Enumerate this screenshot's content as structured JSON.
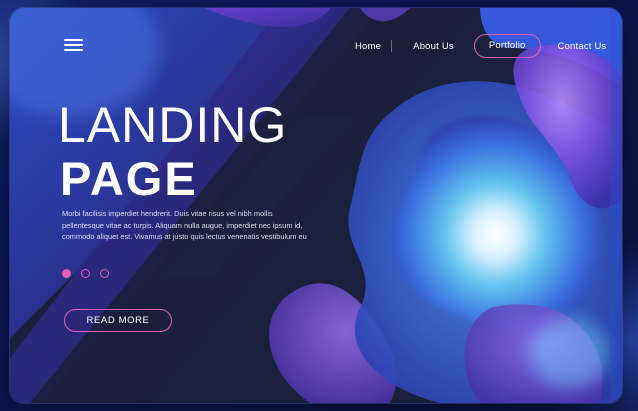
{
  "colors": {
    "accent": "#e45fb4",
    "card_background": "#1a1f3b",
    "outer_background": "#0b1652",
    "text": "#ffffff"
  },
  "nav": {
    "menu_icon": "hamburger-menu-icon",
    "items": [
      {
        "label": "Home",
        "active": false
      },
      {
        "label": "About Us",
        "active": false
      },
      {
        "label": "Portfolio",
        "active": true
      },
      {
        "label": "Contact Us",
        "active": false
      }
    ]
  },
  "hero": {
    "title_line1": "LANDING",
    "title_line2": "PAGE",
    "body_lines": [
      "Morbi facilisis imperdiet hendrerit. Duis vitae risus vel nibh mollis",
      "pellentesque vitae ac turpis. Aliquam nulla augue, imperdiet nec ipsum id,",
      "commodo aliquet est. Vivamus at justo quis lectus venenatis vestibulum eu"
    ],
    "slider": {
      "count": 3,
      "active_index": 0
    },
    "cta_label": "READ MORE"
  }
}
